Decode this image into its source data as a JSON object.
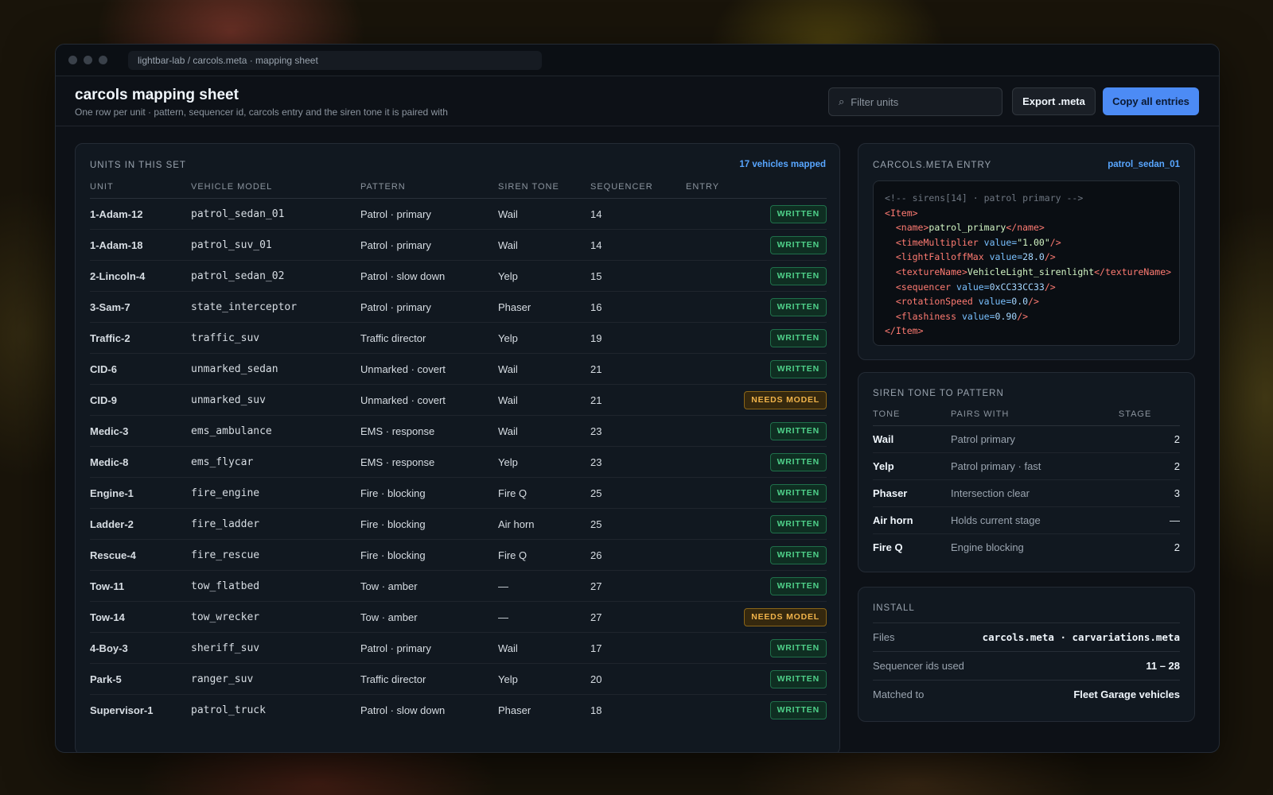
{
  "window": {
    "address": "lightbar-lab / carcols.meta · mapping sheet"
  },
  "header": {
    "title": "carcols mapping sheet",
    "subtitle": "One row per unit · pattern, sequencer id, carcols entry and the siren tone it is paired with",
    "filter_placeholder": "Filter units",
    "export_label": "Export .meta",
    "copy_label": "Copy all entries"
  },
  "units": {
    "label": "UNITS IN THIS SET",
    "mapped": "17 vehicles mapped",
    "columns": [
      "UNIT",
      "VEHICLE MODEL",
      "PATTERN",
      "SIREN TONE",
      "SEQUENCER",
      "ENTRY"
    ],
    "rows": [
      {
        "unit": "1-Adam-12",
        "model": "patrol_sedan_01",
        "pattern": "Patrol · primary",
        "tone": "Wail",
        "seq": "14",
        "entry": "WRITTEN"
      },
      {
        "unit": "1-Adam-18",
        "model": "patrol_suv_01",
        "pattern": "Patrol · primary",
        "tone": "Wail",
        "seq": "14",
        "entry": "WRITTEN"
      },
      {
        "unit": "2-Lincoln-4",
        "model": "patrol_sedan_02",
        "pattern": "Patrol · slow down",
        "tone": "Yelp",
        "seq": "15",
        "entry": "WRITTEN"
      },
      {
        "unit": "3-Sam-7",
        "model": "state_interceptor",
        "pattern": "Patrol · primary",
        "tone": "Phaser",
        "seq": "16",
        "entry": "WRITTEN"
      },
      {
        "unit": "Traffic-2",
        "model": "traffic_suv",
        "pattern": "Traffic director",
        "tone": "Yelp",
        "seq": "19",
        "entry": "WRITTEN"
      },
      {
        "unit": "CID-6",
        "model": "unmarked_sedan",
        "pattern": "Unmarked · covert",
        "tone": "Wail",
        "seq": "21",
        "entry": "WRITTEN"
      },
      {
        "unit": "CID-9",
        "model": "unmarked_suv",
        "pattern": "Unmarked · covert",
        "tone": "Wail",
        "seq": "21",
        "entry": "NEEDS MODEL"
      },
      {
        "unit": "Medic-3",
        "model": "ems_ambulance",
        "pattern": "EMS · response",
        "tone": "Wail",
        "seq": "23",
        "entry": "WRITTEN"
      },
      {
        "unit": "Medic-8",
        "model": "ems_flycar",
        "pattern": "EMS · response",
        "tone": "Yelp",
        "seq": "23",
        "entry": "WRITTEN"
      },
      {
        "unit": "Engine-1",
        "model": "fire_engine",
        "pattern": "Fire · blocking",
        "tone": "Fire Q",
        "seq": "25",
        "entry": "WRITTEN"
      },
      {
        "unit": "Ladder-2",
        "model": "fire_ladder",
        "pattern": "Fire · blocking",
        "tone": "Air horn",
        "seq": "25",
        "entry": "WRITTEN"
      },
      {
        "unit": "Rescue-4",
        "model": "fire_rescue",
        "pattern": "Fire · blocking",
        "tone": "Fire Q",
        "seq": "26",
        "entry": "WRITTEN"
      },
      {
        "unit": "Tow-11",
        "model": "tow_flatbed",
        "pattern": "Tow · amber",
        "tone": "—",
        "seq": "27",
        "entry": "WRITTEN"
      },
      {
        "unit": "Tow-14",
        "model": "tow_wrecker",
        "pattern": "Tow · amber",
        "tone": "—",
        "seq": "27",
        "entry": "NEEDS MODEL"
      },
      {
        "unit": "4-Boy-3",
        "model": "sheriff_suv",
        "pattern": "Patrol · primary",
        "tone": "Wail",
        "seq": "17",
        "entry": "WRITTEN"
      },
      {
        "unit": "Park-5",
        "model": "ranger_suv",
        "pattern": "Traffic director",
        "tone": "Yelp",
        "seq": "20",
        "entry": "WRITTEN"
      },
      {
        "unit": "Supervisor-1",
        "model": "patrol_truck",
        "pattern": "Patrol · slow down",
        "tone": "Phaser",
        "seq": "18",
        "entry": "WRITTEN"
      }
    ]
  },
  "carcols_entry": {
    "label": "CARCOLS.META ENTRY",
    "name": "patrol_sedan_01",
    "comment": "<!-- sirens[14] · patrol primary -->",
    "item_tag": "Item",
    "fields": {
      "name": "patrol_primary",
      "timeMultiplier": "1.00",
      "lightFalloffMax": "28.0",
      "textureName": "VehicleLight_sirenlight",
      "sequencer": "0xCC33CC33",
      "rotationSpeed": "0.0",
      "flashiness": "0.90"
    }
  },
  "tones": {
    "label": "SIREN TONE TO PATTERN",
    "columns": [
      "TONE",
      "PAIRS WITH",
      "STAGE"
    ],
    "rows": [
      {
        "tone": "Wail",
        "pairs": "Patrol primary",
        "stage": "2"
      },
      {
        "tone": "Yelp",
        "pairs": "Patrol primary · fast",
        "stage": "2"
      },
      {
        "tone": "Phaser",
        "pairs": "Intersection clear",
        "stage": "3"
      },
      {
        "tone": "Air horn",
        "pairs": "Holds current stage",
        "stage": "—"
      },
      {
        "tone": "Fire Q",
        "pairs": "Engine blocking",
        "stage": "2"
      }
    ]
  },
  "install": {
    "label": "INSTALL",
    "rows": [
      {
        "key": "Files",
        "value": "carcols.meta · carvariations.meta",
        "mono": true
      },
      {
        "key": "Sequencer ids used",
        "value": "11 – 28",
        "mono": false
      },
      {
        "key": "Matched to",
        "value": "Fleet Garage vehicles",
        "mono": false
      }
    ]
  },
  "colors": {
    "accent": "#4c8bf5",
    "written": "#4fd18a",
    "needs_model": "#f0b34a"
  }
}
